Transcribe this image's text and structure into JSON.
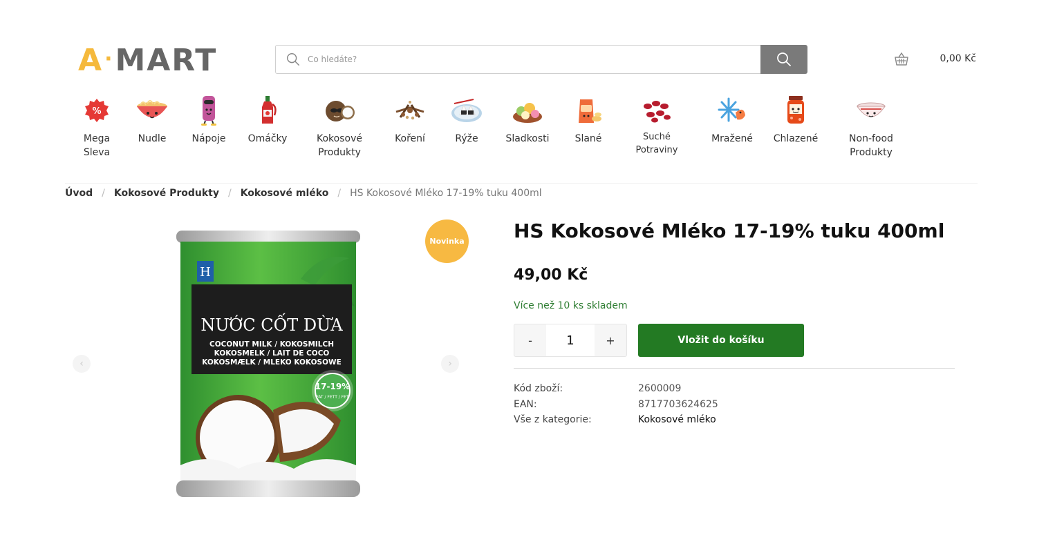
{
  "logo": {
    "part1": "A",
    "separator": "·",
    "part2": "MART"
  },
  "search": {
    "placeholder": "Co hledáte?"
  },
  "cart": {
    "total": "0,00 Kč"
  },
  "categories": [
    {
      "label": "Mega\nSleva",
      "icon": "percent-tag-icon"
    },
    {
      "label": "Nudle",
      "icon": "noodle-bowl-icon"
    },
    {
      "label": "Nápoje",
      "icon": "drink-can-icon"
    },
    {
      "label": "Omáčky",
      "icon": "sauce-bottle-icon"
    },
    {
      "label": "Kokosové\nProdukty",
      "icon": "coconut-icon"
    },
    {
      "label": "Koření",
      "icon": "spices-icon"
    },
    {
      "label": "Rýže",
      "icon": "rice-plate-icon"
    },
    {
      "label": "Sladkosti",
      "icon": "sweets-icon"
    },
    {
      "label": "Slané",
      "icon": "snack-bag-icon"
    },
    {
      "label": "Suché\nPotraviny",
      "icon": "dried-goods-icon"
    },
    {
      "label": "Mražené",
      "icon": "frozen-shrimp-icon"
    },
    {
      "label": "Chlazené",
      "icon": "jar-icon"
    },
    {
      "label": "Non-food\nProdukty",
      "icon": "bowl-icon"
    }
  ],
  "breadcrumb": {
    "home": "Úvod",
    "level1": "Kokosové Produkty",
    "level2": "Kokosové mléko",
    "current": "HS Kokosové Mléko 17-19% tuku 400ml",
    "separator": "/"
  },
  "gallery": {
    "badge": "Novinka",
    "can_text": {
      "brand_mark": "H",
      "headline": "NƯỚC CỐT DỪA",
      "line1": "COCONUT MILK / KOKOSMILCH",
      "line2": "KOKOSMELK / LAIT DE COCO",
      "line3": "KOKOSMÆLK / MLEKO KOKOSOWE",
      "fat": "17-19%",
      "fat_sub": "FAT / FETT / FET"
    }
  },
  "product": {
    "title": "HS Kokosové Mléko 17-19% tuku 400ml",
    "price": "49,00 Kč",
    "stock": "Více než 10 ks skladem",
    "quantity": "1",
    "minus": "-",
    "plus": "+",
    "add_to_cart": "Vložit do košíku",
    "meta": [
      {
        "key": "Kód zboží:",
        "value": "2600009"
      },
      {
        "key": "EAN:",
        "value": "8717703624625"
      },
      {
        "key": "Vše z kategorie:",
        "value": "Kokosové mléko"
      }
    ]
  },
  "colors": {
    "brand_yellow": "#f5b93c",
    "brand_gray": "#666666",
    "add_button_green": "#237a23",
    "stock_green": "#2e7d32",
    "badge_orange": "#f7b942",
    "can_green": "#4caf3d"
  }
}
